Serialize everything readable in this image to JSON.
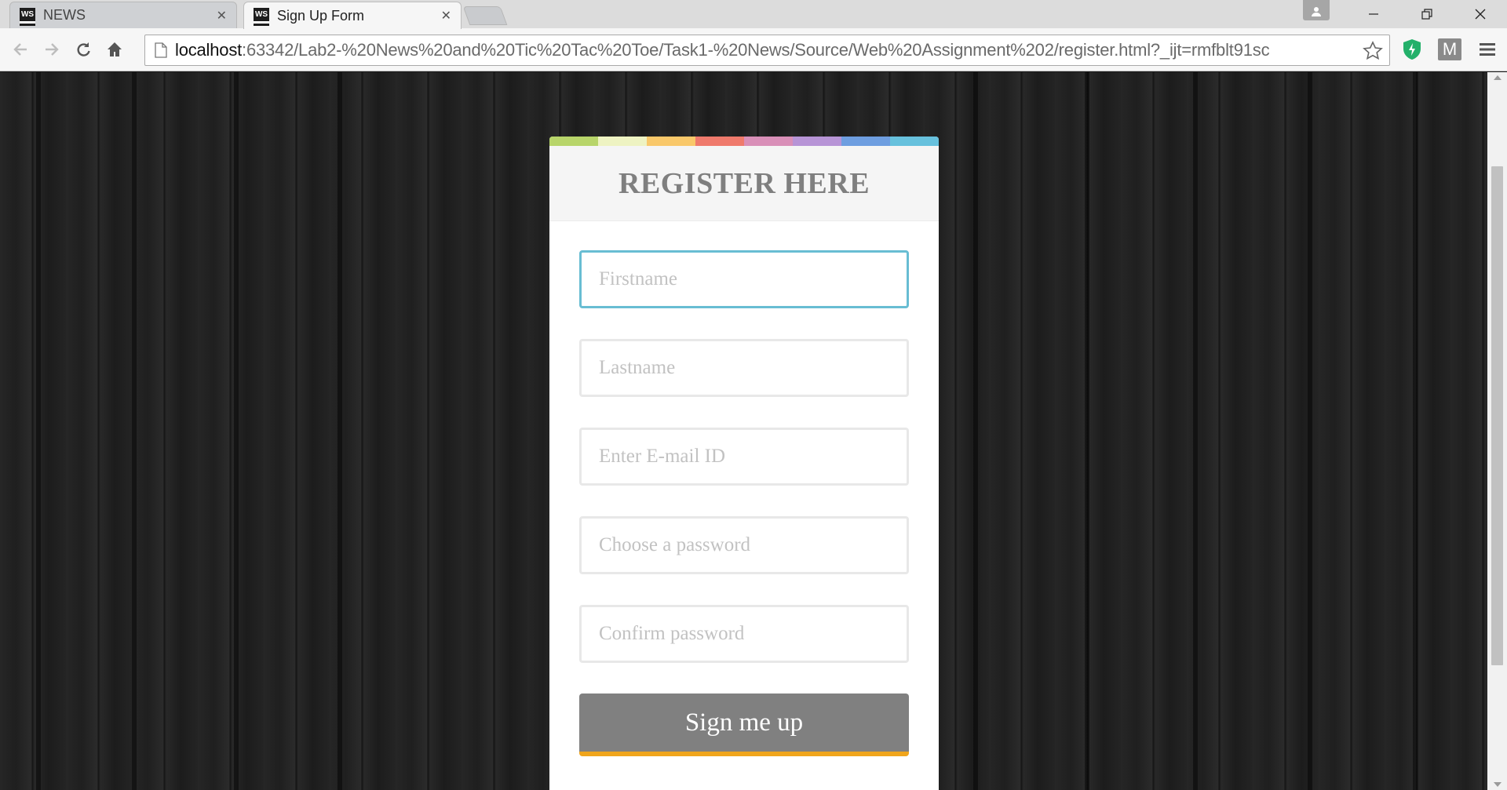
{
  "browser": {
    "tabs": [
      {
        "icon": "WS",
        "label": "NEWS"
      },
      {
        "icon": "WS",
        "label": "Sign Up Form"
      }
    ],
    "url_host": "localhost",
    "url_rest": ":63342/Lab2-%20News%20and%20Tic%20Tac%20Toe/Task1-%20News/Source/Web%20Assignment%202/register.html?_ijt=rmfblt91sc",
    "extension_m_label": "M"
  },
  "form": {
    "title": "REGISTER HERE",
    "firstname_placeholder": "Firstname",
    "lastname_placeholder": "Lastname",
    "email_placeholder": "Enter E-mail ID",
    "password_placeholder": "Choose a password",
    "confirm_placeholder": "Confirm password",
    "submit_label": "Sign me up"
  },
  "colors": {
    "rainbow": [
      "#b8d56a",
      "#eef3c2",
      "#f9c86a",
      "#ef7a6c",
      "#d98fb8",
      "#b794d6",
      "#6e9ee0",
      "#67c1dd"
    ],
    "focus_border": "#68bdd3",
    "button_bg": "#808080",
    "button_accent": "#f0a51b"
  }
}
